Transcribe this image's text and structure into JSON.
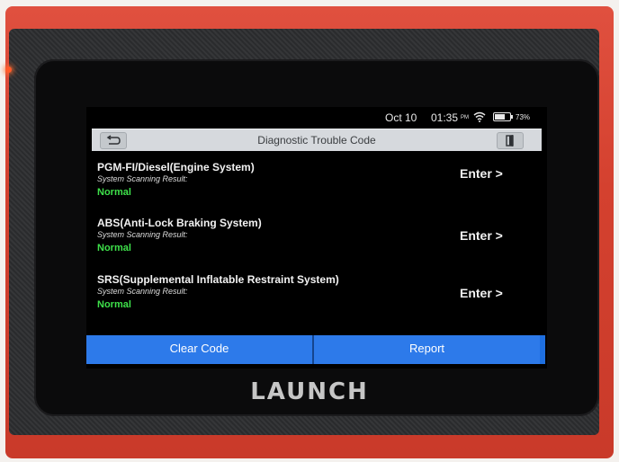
{
  "status_bar": {
    "date": "Oct 10",
    "time": "01:35",
    "ampm": "PM",
    "battery": "73%",
    "battery_level": 0.73
  },
  "header": {
    "title": "Diagnostic Trouble Code",
    "back_icon": "back-arrow-icon",
    "exit_icon": "exit-door-icon"
  },
  "systems": [
    {
      "name": "PGM-FI/Diesel(Engine System)",
      "result_label": "System Scanning Result:",
      "result": "Normal",
      "enter_label": "Enter >"
    },
    {
      "name": "ABS(Anti-Lock Braking System)",
      "result_label": "System Scanning Result:",
      "result": "Normal",
      "enter_label": "Enter >"
    },
    {
      "name": "SRS(Supplemental Inflatable Restraint System)",
      "result_label": "System Scanning Result:",
      "result": "Normal",
      "enter_label": "Enter >"
    }
  ],
  "actions": {
    "clear_code": "Clear Code",
    "report": "Report"
  },
  "device": {
    "brand": "LAUNCH"
  },
  "colors": {
    "shell": "#d4412f",
    "action_bar": "#2d7aea",
    "status_ok": "#3ee04a",
    "title_bar": "#d6d9dd"
  }
}
